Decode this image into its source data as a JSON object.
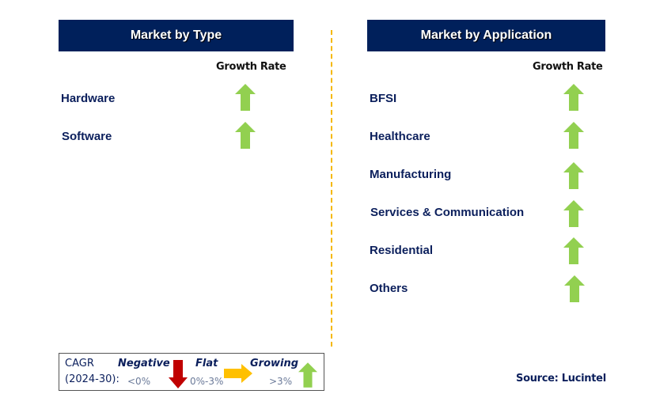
{
  "type_panel": {
    "title": "Market by Type",
    "growth_header": "Growth Rate",
    "items": [
      {
        "label": "Hardware",
        "trend": "growing"
      },
      {
        "label": "Software",
        "trend": "growing"
      }
    ]
  },
  "application_panel": {
    "title": "Market by Application",
    "growth_header": "Growth Rate",
    "items": [
      {
        "label": "BFSI",
        "trend": "growing"
      },
      {
        "label": "Healthcare",
        "trend": "growing"
      },
      {
        "label": "Manufacturing",
        "trend": "growing"
      },
      {
        "label": "Services & Communication",
        "trend": "growing"
      },
      {
        "label": "Residential",
        "trend": "growing"
      },
      {
        "label": "Others",
        "trend": "growing"
      }
    ]
  },
  "legend": {
    "cagr_label": "CAGR",
    "period": "(2024-30):",
    "negative": {
      "label": "Negative",
      "range": "<0%",
      "icon": "down-arrow-icon",
      "color": "#c00000"
    },
    "flat": {
      "label": "Flat",
      "range": "0%-3%",
      "icon": "right-arrow-icon",
      "color": "#ffc000"
    },
    "growing": {
      "label": "Growing",
      "range": ">3%",
      "icon": "up-arrow-icon",
      "color": "#92d050"
    }
  },
  "source": "Source: Lucintel",
  "colors": {
    "header_bg": "#00205b",
    "label": "#0b1f5c",
    "divider": "#f5b800"
  }
}
